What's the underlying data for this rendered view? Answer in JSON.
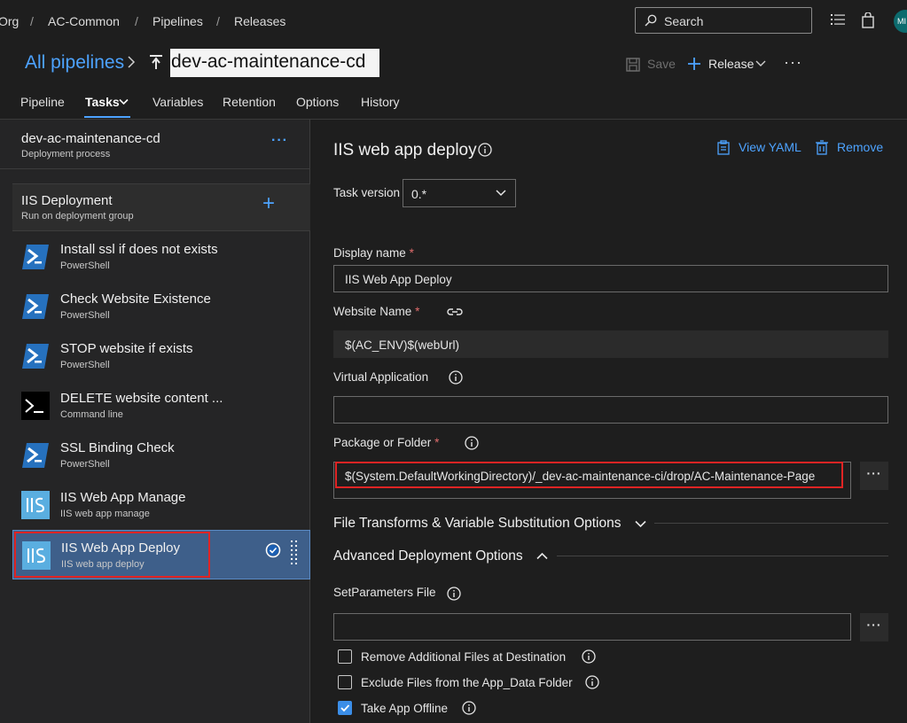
{
  "breadcrumb": {
    "org": "Org",
    "project": "AC-Common",
    "pipelines": "Pipelines",
    "releases": "Releases"
  },
  "search": {
    "label": "Search"
  },
  "avatar": {
    "initials": "MI"
  },
  "header": {
    "all_pipelines": "All pipelines",
    "pipeline_name": "dev-ac-maintenance-cd",
    "save_label": "Save",
    "release_label": "Release"
  },
  "tabs": [
    {
      "label": "Pipeline"
    },
    {
      "label": "Tasks"
    },
    {
      "label": "Variables"
    },
    {
      "label": "Retention"
    },
    {
      "label": "Options"
    },
    {
      "label": "History"
    }
  ],
  "process": {
    "title": "dev-ac-maintenance-cd",
    "subtitle": "Deployment process"
  },
  "job": {
    "title": "IIS Deployment",
    "subtitle": "Run on deployment group"
  },
  "tasks": [
    {
      "name": "Install ssl if does not exists",
      "type": "PowerShell",
      "icon": "powershell-icon"
    },
    {
      "name": "Check Website Existence",
      "type": "PowerShell",
      "icon": "powershell-icon"
    },
    {
      "name": "STOP website if exists",
      "type": "PowerShell",
      "icon": "powershell-icon"
    },
    {
      "name": "DELETE website content ...",
      "type": "Command line",
      "icon": "terminal-icon"
    },
    {
      "name": "SSL Binding Check",
      "type": "PowerShell",
      "icon": "powershell-icon"
    },
    {
      "name": "IIS Web App Manage",
      "type": "IIS web app manage",
      "icon": "iis-icon"
    },
    {
      "name": "IIS Web App Deploy",
      "type": "IIS web app deploy",
      "icon": "iis-icon",
      "selected": true
    }
  ],
  "detail": {
    "title": "IIS web app deploy",
    "view_yaml": "View YAML",
    "remove": "Remove",
    "task_version_label": "Task version",
    "task_version_value": "0.*",
    "display_name_label": "Display name",
    "display_name_value": "IIS Web App Deploy",
    "website_name_label": "Website Name",
    "website_name_value": "$(AC_ENV)$(webUrl)",
    "virtual_app_label": "Virtual Application",
    "virtual_app_value": "",
    "package_label": "Package or Folder",
    "package_value": "$(System.DefaultWorkingDirectory)/_dev-ac-maintenance-ci/drop/AC-Maintenance-Page",
    "file_transforms_label": "File Transforms & Variable Substitution Options",
    "advanced_label": "Advanced Deployment Options",
    "setparams_label": "SetParameters File",
    "setparams_value": "",
    "remove_additional_label": "Remove Additional Files at Destination",
    "remove_additional_checked": false,
    "exclude_appdata_label": "Exclude Files from the App_Data Folder",
    "exclude_appdata_checked": false,
    "take_offline_label": "Take App Offline",
    "take_offline_checked": true
  },
  "colors": {
    "accent": "#4da3ff",
    "highlight_box": "#e02424",
    "selected_task_bg": "#3e5f8a"
  }
}
